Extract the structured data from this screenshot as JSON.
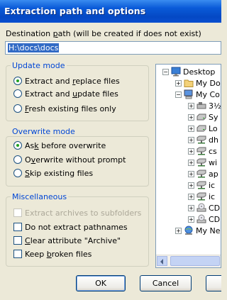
{
  "window": {
    "title": "Extraction path and options"
  },
  "destination": {
    "label_pre": "Destination ",
    "label_u": "p",
    "label_post": "ath (will be created if does not exist)",
    "value": "H:\\docs\\docs"
  },
  "update_mode": {
    "legend": "Update mode",
    "options": [
      {
        "pre": "Extract and ",
        "u": "r",
        "post": "eplace files",
        "checked": true
      },
      {
        "pre": "Extract and ",
        "u": "u",
        "post": "pdate files",
        "checked": false
      },
      {
        "pre": "",
        "u": "F",
        "post": "resh existing files only",
        "checked": false
      }
    ]
  },
  "overwrite_mode": {
    "legend": "Overwrite mode",
    "options": [
      {
        "pre": "As",
        "u": "k",
        "post": " before overwrite",
        "checked": true
      },
      {
        "pre": "O",
        "u": "v",
        "post": "erwrite without prompt",
        "checked": false
      },
      {
        "pre": "",
        "u": "S",
        "post": "kip existing files",
        "checked": false
      }
    ]
  },
  "misc": {
    "legend": "Miscellaneous",
    "options": [
      {
        "pre": "Extract archives to subfolders",
        "u": "",
        "post": "",
        "checked": false,
        "disabled": true
      },
      {
        "pre": "Do not extract pathnames",
        "u": "",
        "post": "",
        "checked": false,
        "disabled": false
      },
      {
        "pre": "",
        "u": "C",
        "post": "lear attribute \"Archive\"",
        "checked": false,
        "disabled": false
      },
      {
        "pre": "Keep ",
        "u": "b",
        "post": "roken files",
        "checked": false,
        "disabled": false
      }
    ]
  },
  "tree": {
    "items": [
      {
        "label": "Desktop",
        "icon": "desktop-icon",
        "expander": "minus"
      },
      {
        "label": "My Do",
        "icon": "folder-icon",
        "expander": "plus"
      },
      {
        "label": "My Co",
        "icon": "computer-icon",
        "expander": "minus"
      },
      {
        "label": "3½",
        "icon": "floppy-drive-icon",
        "expander": "plus"
      },
      {
        "label": "Sy",
        "icon": "hard-drive-icon",
        "expander": "plus"
      },
      {
        "label": "Lo",
        "icon": "hard-drive-icon",
        "expander": "plus"
      },
      {
        "label": "dh",
        "icon": "network-drive-icon",
        "expander": "plus"
      },
      {
        "label": "cs",
        "icon": "network-drive-icon",
        "expander": "plus"
      },
      {
        "label": "wi",
        "icon": "network-drive-icon",
        "expander": "plus"
      },
      {
        "label": "ap",
        "icon": "network-drive-icon",
        "expander": "plus"
      },
      {
        "label": "ic",
        "icon": "network-drive-icon",
        "expander": "plus"
      },
      {
        "label": "ic",
        "icon": "network-drive-icon",
        "expander": "plus"
      },
      {
        "label": "CD",
        "icon": "cd-drive-icon",
        "expander": "plus"
      },
      {
        "label": "CD",
        "icon": "cd-drive-icon",
        "expander": "plus"
      },
      {
        "label": "My Ne",
        "icon": "network-places-icon",
        "expander": "plus"
      }
    ]
  },
  "buttons": {
    "ok": "OK",
    "cancel": "Cancel"
  }
}
